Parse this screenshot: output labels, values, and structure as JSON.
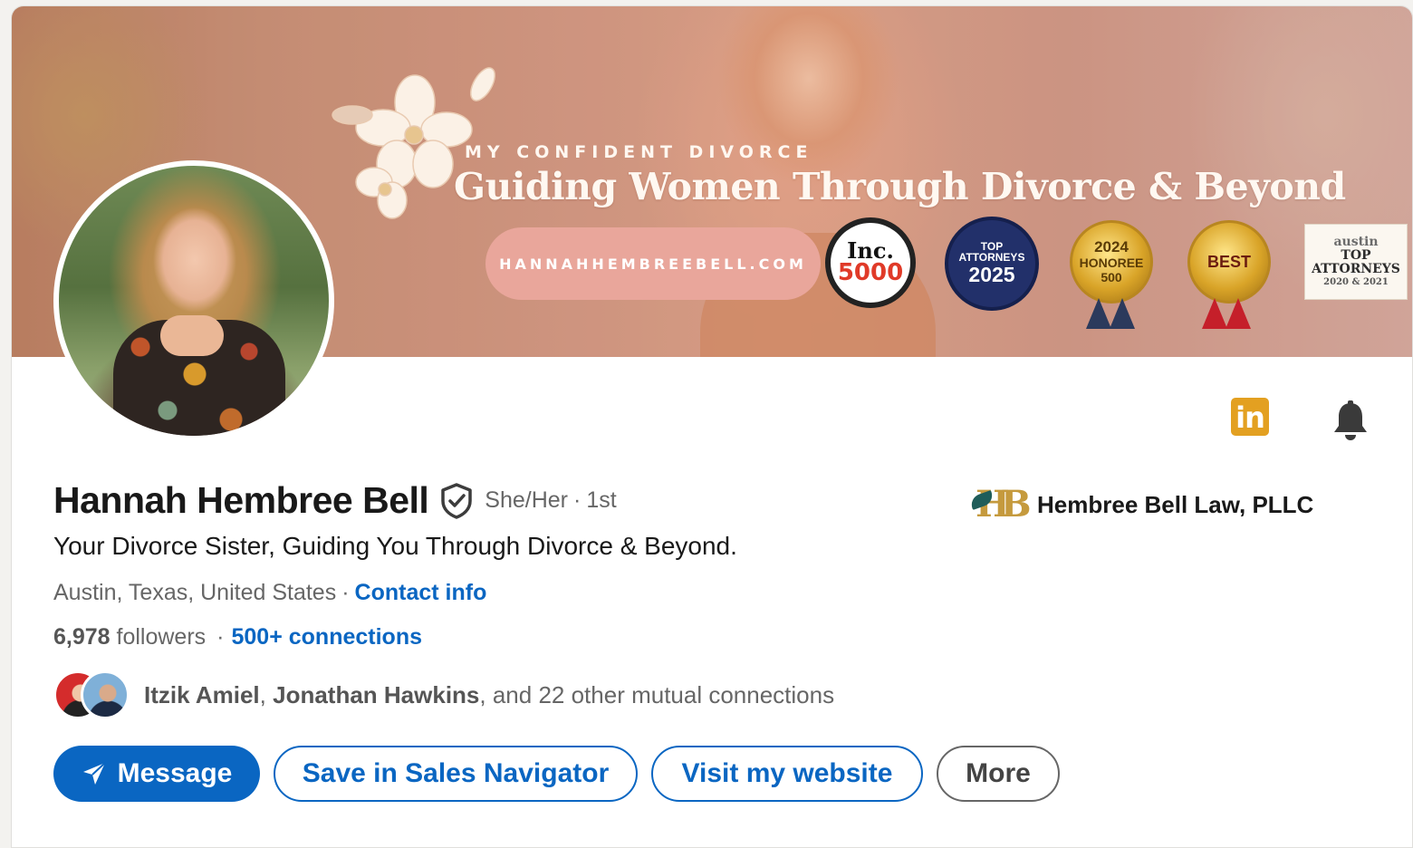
{
  "banner": {
    "kicker": "MY CONFIDENT DIVORCE",
    "title": "Guiding Women Through Divorce & Beyond",
    "url": "HANNAHHEMBREEBELL.COM",
    "badges": {
      "inc_line1": "Inc.",
      "inc_line2": "5000",
      "top_line1": "TOP",
      "top_line2": "ATTORNEYS",
      "top_year": "2025",
      "honoree_year": "2024",
      "honoree_label": "HONOREE",
      "honoree_sub": "500",
      "best_label": "BEST",
      "austin_line1": "austin",
      "austin_line2": "TOP",
      "austin_line3": "ATTORNEYS",
      "austin_years": "2020 & 2021"
    }
  },
  "profile": {
    "name": "Hannah Hembree Bell",
    "pronouns": "She/Her",
    "degree_separator": "·",
    "degree": "1st",
    "headline": "Your Divorce Sister, Guiding You Through Divorce & Beyond.",
    "location": "Austin, Texas, United States",
    "location_separator": "·",
    "contact_info_label": "Contact info",
    "followers_count": "6,978",
    "followers_label": "followers",
    "stats_separator": "·",
    "connections_label": "500+ connections",
    "mutual": {
      "name1": "Itzik Amiel",
      "comma": ",",
      "name2": "Jonathan Hawkins",
      "rest": ", and 22 other mutual connections"
    }
  },
  "company": {
    "name": "Hembree Bell Law, PLLC",
    "logo_text": "HB"
  },
  "actions": {
    "message_label": "Message",
    "sales_navigator_label": "Save in Sales Navigator",
    "website_label": "Visit my website",
    "more_label": "More"
  },
  "icons": {
    "linkedin_glyph": "in"
  },
  "colors": {
    "brand_blue": "#0a66c2",
    "linkedin_icon_gold": "#e3a021",
    "secondary_text": "#666666"
  }
}
